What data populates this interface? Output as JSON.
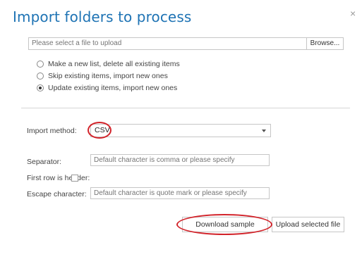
{
  "dialog": {
    "title": "Import folders to process",
    "close_glyph": "×",
    "file": {
      "placeholder": "Please select a file to upload",
      "browse_label": "Browse..."
    },
    "options": [
      {
        "label": "Make a new list, delete all existing items",
        "checked": false
      },
      {
        "label": "Skip existing items, import new ones",
        "checked": false
      },
      {
        "label": "Update existing items, import new ones",
        "checked": true
      }
    ],
    "import_method": {
      "label": "Import method:",
      "selected": "CSV"
    },
    "separator": {
      "label": "Separator:",
      "placeholder": "Default character is comma or please specify"
    },
    "first_row_header": {
      "label": "First row is header:",
      "checked": false
    },
    "escape_character": {
      "label": "Escape character:",
      "placeholder": "Default character is quote mark or please specify"
    },
    "buttons": {
      "download_sample": "Download sample",
      "upload_selected": "Upload selected file"
    },
    "accent_color": "#1e73b4",
    "annotation_color": "#d2232a"
  }
}
